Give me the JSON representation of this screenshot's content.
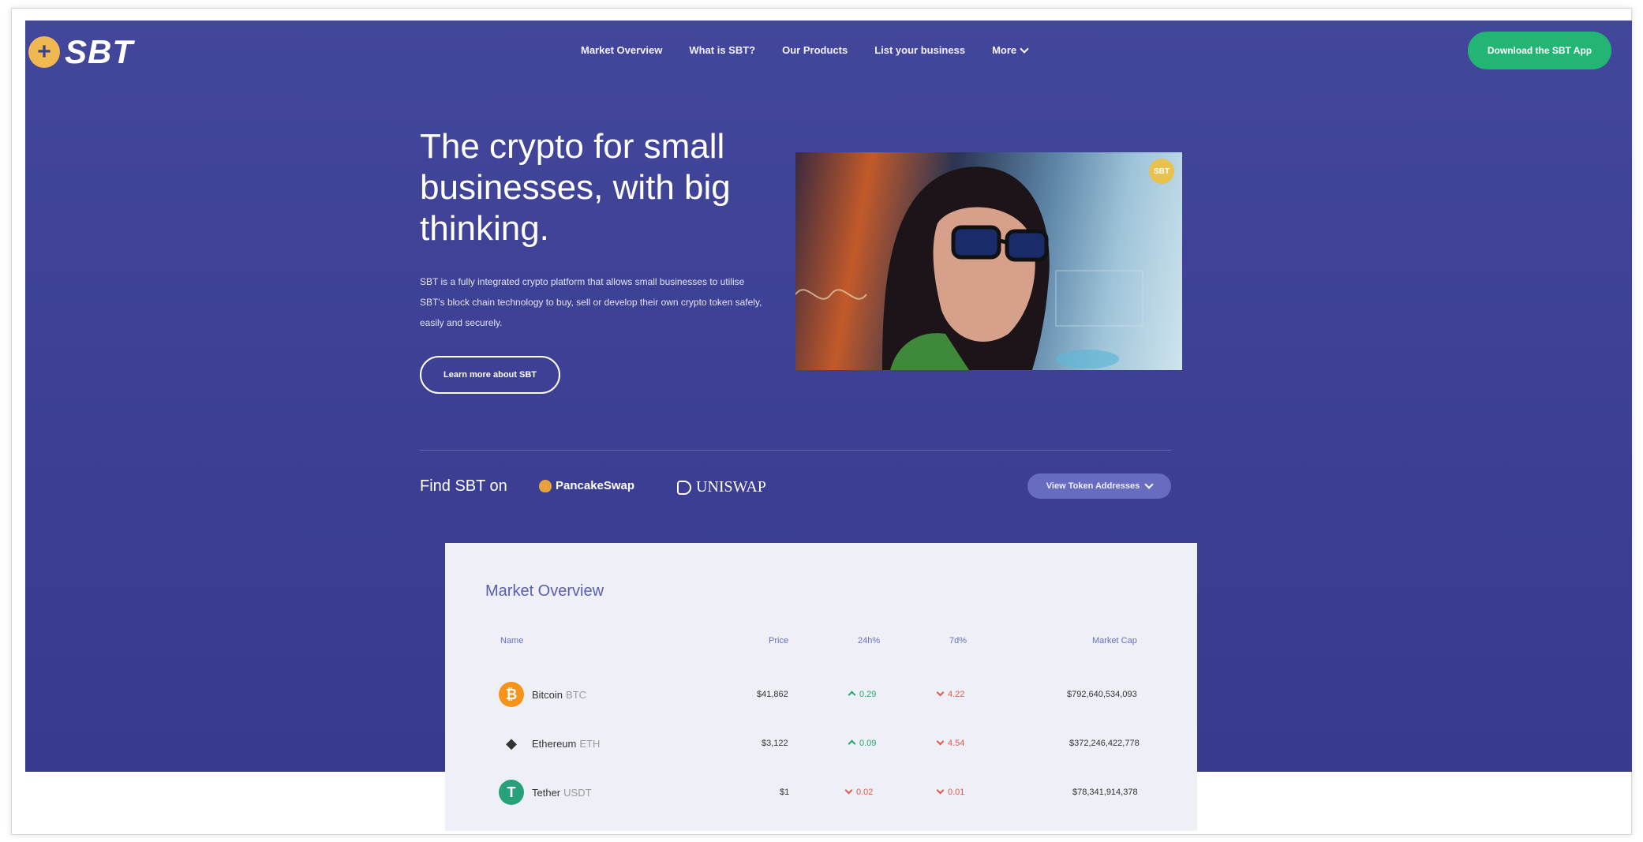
{
  "brand": {
    "name": "SBT",
    "coin_glyph": "+"
  },
  "nav": {
    "items": [
      {
        "label": "Market Overview"
      },
      {
        "label": "What is SBT?"
      },
      {
        "label": "Our Products"
      },
      {
        "label": "List your business"
      },
      {
        "label": "More"
      }
    ],
    "cta_label": "Download the SBT App"
  },
  "hero": {
    "headline": "The crypto for small businesses, with big thinking.",
    "description": "SBT is a fully integrated crypto platform that allows small businesses to utilise SBT's block chain technology to buy, sell or develop their own crypto token safely, easily and securely.",
    "learn_more_label": "Learn more about SBT",
    "image_badge": "SBT"
  },
  "find": {
    "label": "Find SBT on",
    "exchanges": [
      {
        "label": "PancakeSwap"
      },
      {
        "label": "UNISWAP"
      }
    ],
    "token_button_label": "View Token Addresses"
  },
  "market": {
    "title": "Market Overview",
    "columns": [
      "Name",
      "Price",
      "24h%",
      "7d%",
      "Market Cap"
    ],
    "rows": [
      {
        "name": "Bitcoin",
        "symbol": "BTC",
        "price": "$41,862",
        "change_24h": "0.29",
        "change_7d": "4.22",
        "market_cap": "$792,640,534,093",
        "icon_glyph": "₿",
        "icon_color": "#f7931a"
      },
      {
        "name": "Ethereum",
        "symbol": "ETH",
        "price": "$3,122",
        "change_24h": "0.09",
        "change_7d": "4.54",
        "market_cap": "$372,246,422,778",
        "icon_glyph": "◆",
        "icon_color": "#444444"
      },
      {
        "name": "Tether",
        "symbol": "USDT",
        "price": "$1",
        "change_24h": "0.02",
        "change_7d": "0.01",
        "market_cap": "$78,341,914,378",
        "icon_glyph": "T",
        "icon_color": "#26a17b"
      }
    ]
  },
  "colors": {
    "hero_bg": "#3e4194",
    "cta_green": "#22b574",
    "accent_gold": "#f0b850",
    "up_green": "#22a86b",
    "down_red": "#e05a4a"
  }
}
